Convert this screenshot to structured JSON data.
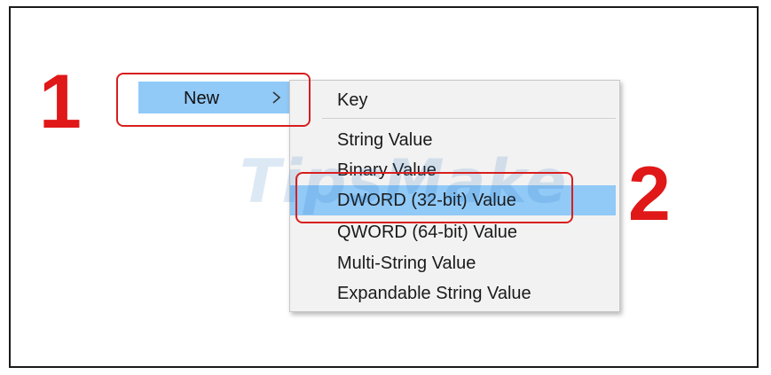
{
  "annotations": {
    "step_1": "1",
    "step_2": "2"
  },
  "parent_menu": {
    "label": "New",
    "chevron_icon": "chevron-right-icon"
  },
  "submenu": {
    "items": [
      {
        "label": "Key"
      },
      {
        "label": "String Value"
      },
      {
        "label": "Binary Value"
      },
      {
        "label": "DWORD (32-bit) Value",
        "selected": true
      },
      {
        "label": "QWORD (64-bit) Value"
      },
      {
        "label": "Multi-String Value"
      },
      {
        "label": "Expandable String Value"
      }
    ]
  },
  "watermark": {
    "text": "TipsMake"
  },
  "colors": {
    "highlight": "#91c9f7",
    "annotation_red": "#e01818",
    "menu_background": "#f2f2f2"
  }
}
